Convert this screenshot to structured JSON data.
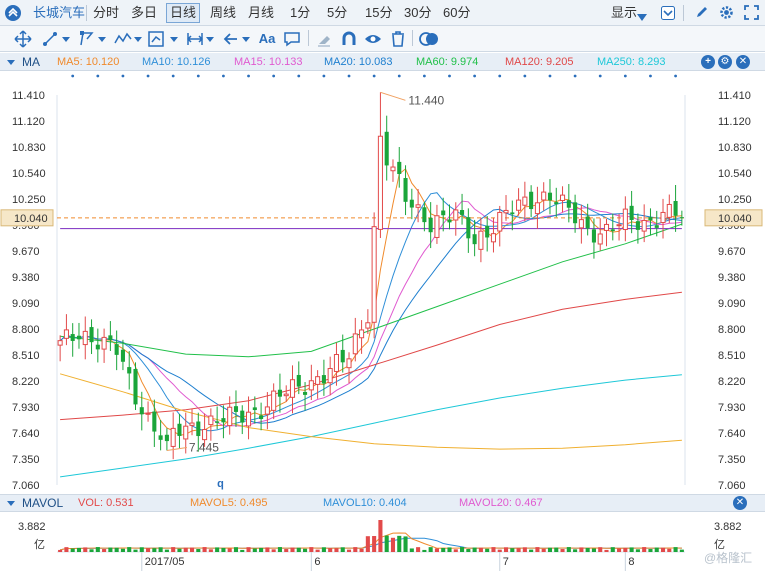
{
  "top_bar": {
    "stock_name": "长城汽车",
    "periods": [
      "分时",
      "多日",
      "日线",
      "周线",
      "月线",
      "1分",
      "5分",
      "15分",
      "30分",
      "60分"
    ],
    "selected_period": "日线",
    "display_label": "显示"
  },
  "ma_bar": {
    "label": "MA",
    "items": [
      {
        "text": "MA5: 10.120",
        "color": "#f08a2c"
      },
      {
        "text": "MA10: 10.126",
        "color": "#2f8fd8"
      },
      {
        "text": "MA15: 10.133",
        "color": "#e05ad0"
      },
      {
        "text": "MA20: 10.083",
        "color": "#1e7fcf"
      },
      {
        "text": "MA60: 9.974",
        "color": "#21c04a"
      },
      {
        "text": "MA120: 9.205",
        "color": "#e04848"
      },
      {
        "text": "MA250: 8.293",
        "color": "#1ec8d8"
      }
    ]
  },
  "vol_bar": {
    "label": "MAVOL",
    "items": [
      {
        "text": "VOL: 0.531",
        "color": "#e24a4a"
      },
      {
        "text": "MAVOL5: 0.495",
        "color": "#f08a2c"
      },
      {
        "text": "MAVOL10: 0.404",
        "color": "#2f8fd8"
      },
      {
        "text": "MAVOL20: 0.467",
        "color": "#e05ad0"
      }
    ]
  },
  "watermark": "@格隆汇",
  "chart_data": {
    "type": "candlestick",
    "yticks": [
      "11.410",
      "11.120",
      "10.830",
      "10.540",
      "10.250",
      "9.960",
      "9.670",
      "9.380",
      "9.090",
      "8.800",
      "8.510",
      "8.220",
      "7.930",
      "7.640",
      "7.350",
      "7.060"
    ],
    "ylim": [
      7.06,
      11.41
    ],
    "current_price": "10.040",
    "annotations": [
      {
        "text": "11.440",
        "kind": "high",
        "value": 11.44
      },
      {
        "text": "7.445",
        "kind": "low",
        "value": 7.445
      },
      {
        "text": "q",
        "kind": "marker"
      }
    ],
    "x_labels": [
      "2017/05",
      "6",
      "7",
      "8"
    ],
    "vol_ticks": [
      "3.882",
      "亿"
    ],
    "vol_unit": "亿",
    "colors": {
      "up": "#e24a4a",
      "down": "#1aa53a",
      "pivot": "#8a44c8"
    }
  }
}
